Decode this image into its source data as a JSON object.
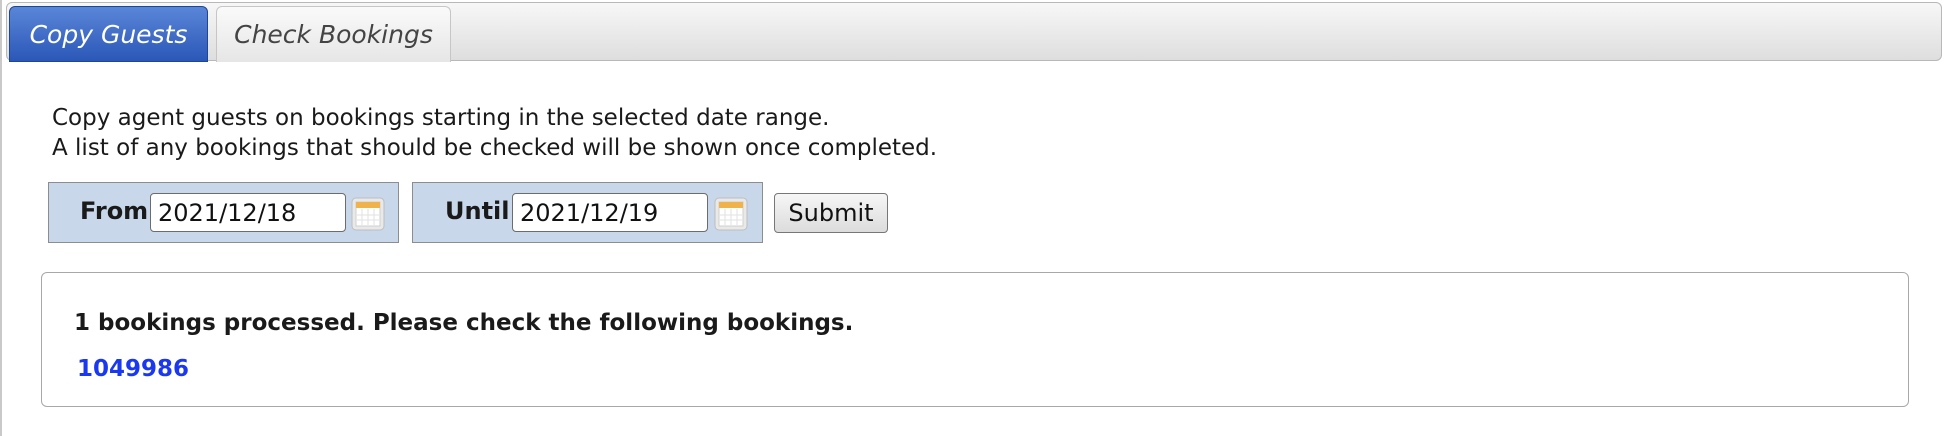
{
  "tabs": [
    {
      "label": "Copy Guests",
      "active": true
    },
    {
      "label": "Check Bookings",
      "active": false
    }
  ],
  "intro": {
    "line1": "Copy agent guests on bookings starting in the selected date range.",
    "line2": "A list of any bookings that should be checked will be shown once completed."
  },
  "form": {
    "from_label": "From",
    "from_value": "2021/12/18",
    "until_label": "Until",
    "until_value": "2021/12/19",
    "calendar_icon": "calendar-icon",
    "submit_label": "Submit"
  },
  "results": {
    "message": "1 bookings processed. Please check the following bookings.",
    "bookings": [
      "1049986"
    ]
  },
  "colors": {
    "active_tab": "#2b57b8",
    "date_box_bg": "#c8d8ea",
    "link": "#1a38f0"
  }
}
